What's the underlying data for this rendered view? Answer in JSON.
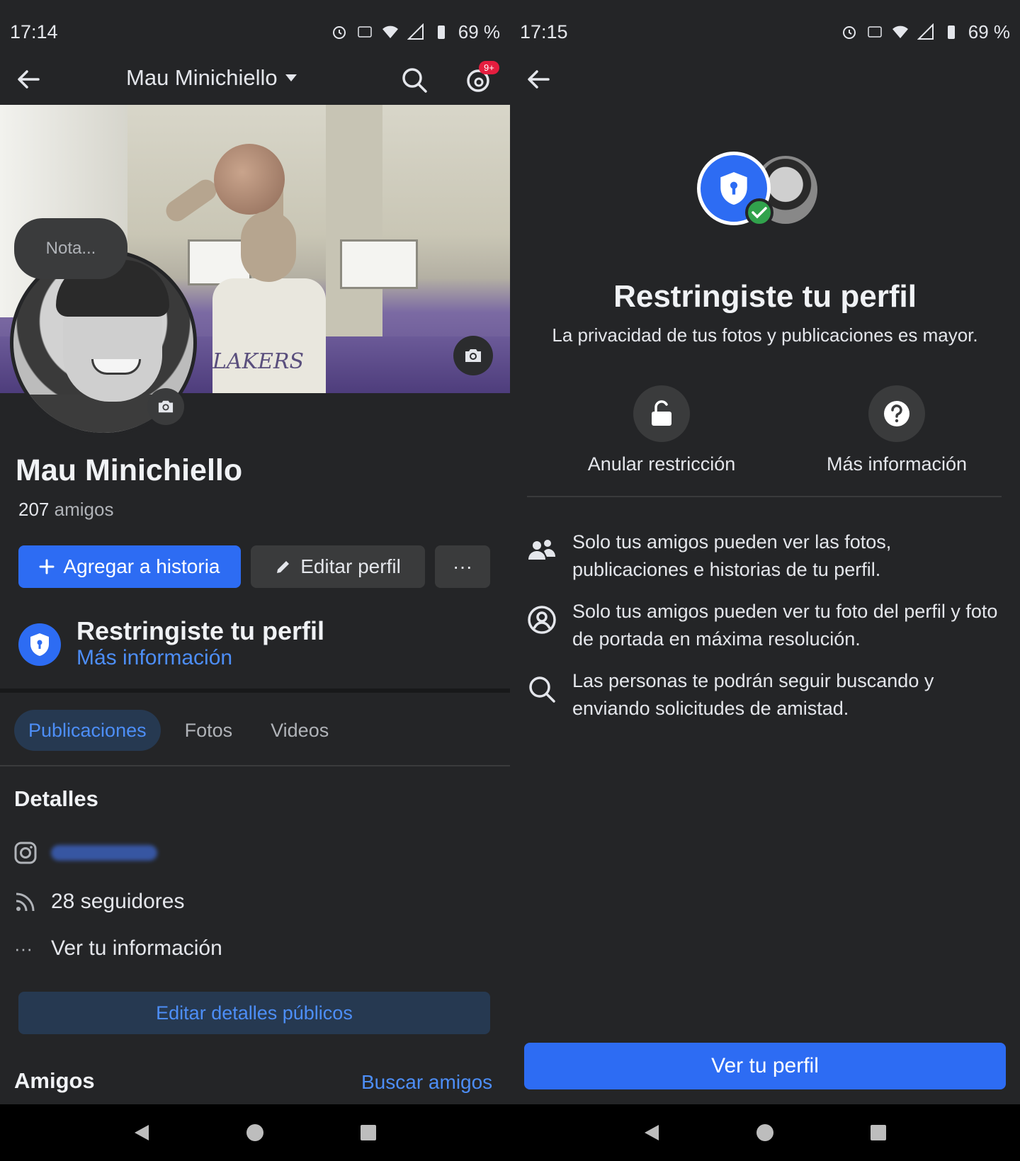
{
  "left": {
    "status": {
      "time": "17:14",
      "battery": "69 %"
    },
    "appbar": {
      "title": "Mau Minichiello",
      "badge": "9+"
    },
    "nota_placeholder": "Nota...",
    "cover_text": "LAKERS",
    "profile": {
      "name": "Mau Minichiello",
      "friends_count": "207",
      "friends_label": "amigos"
    },
    "buttons": {
      "add_story": "Agregar a historia",
      "edit_profile": "Editar perfil",
      "more": "···"
    },
    "restriction": {
      "title": "Restringiste tu perfil",
      "link": "Más información"
    },
    "tabs": [
      {
        "label": "Publicaciones",
        "active": true
      },
      {
        "label": "Fotos",
        "active": false
      },
      {
        "label": "Videos",
        "active": false
      }
    ],
    "details": {
      "title": "Detalles",
      "followers": "28 seguidores",
      "see_info": "Ver tu información",
      "edit_public": "Editar detalles públicos"
    },
    "friends_section": {
      "title": "Amigos",
      "find": "Buscar amigos"
    }
  },
  "right": {
    "status": {
      "time": "17:15",
      "battery": "69 %"
    },
    "title": "Restringiste tu perfil",
    "subtitle": "La privacidad de tus fotos y publicaciones es mayor.",
    "actions": {
      "unrestrict": "Anular restricción",
      "more_info": "Más información"
    },
    "info": [
      {
        "icon": "friends-icon",
        "text": "Solo tus amigos pueden ver las fotos, publicaciones e historias de tu perfil."
      },
      {
        "icon": "profile-circle-icon",
        "text": "Solo tus amigos pueden ver tu foto del perfil y foto de portada en máxima resolución."
      },
      {
        "icon": "search-icon",
        "text": "Las personas te podrán seguir buscando y enviando solicitudes de amistad."
      }
    ],
    "cta": "Ver tu perfil"
  },
  "colors": {
    "background": "#242527",
    "accent": "#2d6cf3",
    "link": "#4d8ef7",
    "success": "#31a24c",
    "badge": "#e41e3f"
  }
}
